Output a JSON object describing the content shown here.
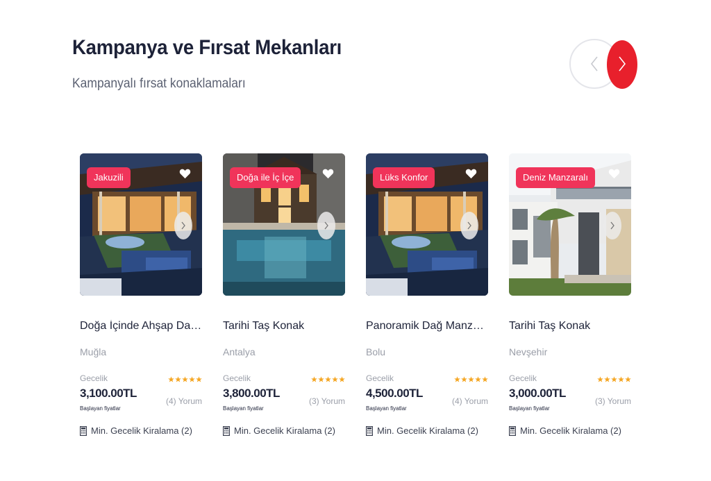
{
  "section": {
    "title": "Kampanya ve Fırsat Mekanları",
    "subtitle": "Kampanyalı fırsat konaklamaları"
  },
  "navigation": {
    "prev_icon": "chevron-left-icon",
    "next_icon": "chevron-right-icon",
    "accent_color": "#e8202c"
  },
  "colors": {
    "tag_background": "#f0345a",
    "star": "#f5a623",
    "title_text": "#1d2238"
  },
  "cards": [
    {
      "tag": "Jakuzili",
      "title": "Doğa İçinde Ahşap Dağ Evi",
      "location": "Muğla",
      "nightly_label": "Gecelik",
      "price": "3,100.00TL",
      "starting_label": "Başlayan fiyatlar",
      "rating_stars": 5,
      "reviews": "(4) Yorum",
      "min_rent": "Min. Gecelik Kiralama (2)"
    },
    {
      "tag": "Doğa ile İç İçe",
      "title": "Tarihi Taş Konak",
      "location": "Antalya",
      "nightly_label": "Gecelik",
      "price": "3,800.00TL",
      "starting_label": "Başlayan fiyatlar",
      "rating_stars": 5,
      "reviews": "(3) Yorum",
      "min_rent": "Min. Gecelik Kiralama (2)"
    },
    {
      "tag": "Lüks Konfor",
      "title": "Panoramik Dağ Manzaralı Vi...",
      "location": "Bolu",
      "nightly_label": "Gecelik",
      "price": "4,500.00TL",
      "starting_label": "Başlayan fiyatlar",
      "rating_stars": 5,
      "reviews": "(4) Yorum",
      "min_rent": "Min. Gecelik Kiralama (2)"
    },
    {
      "tag": "Deniz Manzaralı",
      "title": "Tarihi Taş Konak",
      "location": "Nevşehir",
      "nightly_label": "Gecelik",
      "price": "3,000.00TL",
      "starting_label": "Başlayan fiyatlar",
      "rating_stars": 5,
      "reviews": "(3) Yorum",
      "min_rent": "Min. Gecelik Kiralama (2)"
    }
  ]
}
